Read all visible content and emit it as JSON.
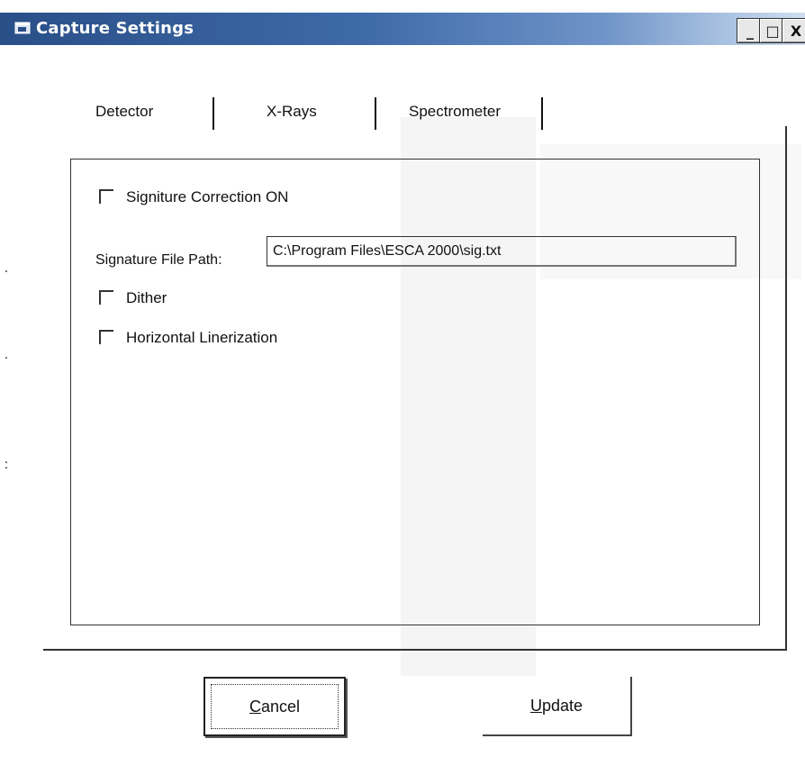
{
  "window": {
    "title": "Capture Settings",
    "controls": {
      "minimize": "_",
      "maximize": "□",
      "close": "X"
    }
  },
  "tabs": [
    {
      "label": "Detector",
      "active": true
    },
    {
      "label": "X-Rays",
      "active": false
    },
    {
      "label": "Spectrometer",
      "active": false
    }
  ],
  "detector": {
    "signature_correction": {
      "label": "Signiture Correction ON",
      "checked": false
    },
    "signature_file_path": {
      "label": "Signature File Path:",
      "value": "C:\\Program Files\\ESCA 2000\\sig.txt"
    },
    "dither": {
      "label": "Dither",
      "checked": false
    },
    "horizontal_linerization": {
      "label": "Horizontal Linerization",
      "checked": false
    }
  },
  "buttons": {
    "cancel": {
      "mnemonic": "C",
      "rest": "ancel"
    },
    "update": {
      "mnemonic": "U",
      "rest": "pdate"
    }
  }
}
